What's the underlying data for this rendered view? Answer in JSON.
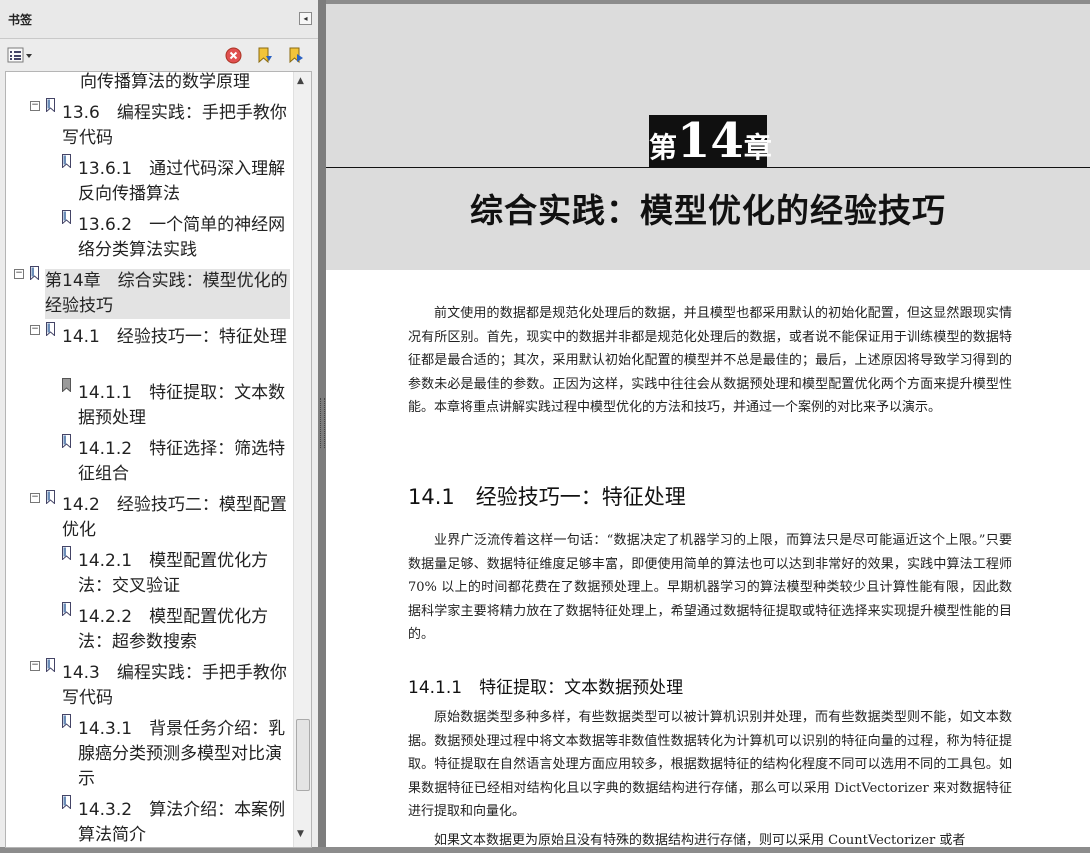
{
  "panel": {
    "title": "书签",
    "collapse_glyph": "◂",
    "toolbar": {
      "options_icon": "list-options-icon",
      "delete_icon": "delete-icon",
      "expand_icon": "expand-bookmark-icon",
      "next_icon": "go-to-bookmark-icon"
    }
  },
  "tree": {
    "items": [
      {
        "label": "向传播算法的数学原理"
      },
      {
        "label": "13.6　编程实践：手把手教你写代码"
      },
      {
        "label": "13.6.1　通过代码深入理解反向传播算法"
      },
      {
        "label": "13.6.2　一个简单的神经网络分类算法实践"
      },
      {
        "label": "第14章　综合实践：模型优化的经验技巧"
      },
      {
        "label": "14.1　经验技巧一：特征处理"
      },
      {
        "label": "14.1.1　特征提取：文本数据预处理"
      },
      {
        "label": "14.1.2　特征选择：筛选特征组合"
      },
      {
        "label": "14.2　经验技巧二：模型配置优化"
      },
      {
        "label": "14.2.1　模型配置优化方法：交叉验证"
      },
      {
        "label": "14.2.2　模型配置优化方法：超参数搜索"
      },
      {
        "label": "14.3　编程实践：手把手教你写代码"
      },
      {
        "label": "14.3.1　背景任务介绍：乳腺癌分类预测多模型对比演示"
      },
      {
        "label": "14.3.2　算法介绍：本案例算法简介"
      }
    ],
    "expander": "−",
    "scroll_up": "▲",
    "scroll_down": "▼"
  },
  "page": {
    "chapter_prefix": "第",
    "chapter_number": "14",
    "chapter_suffix": "章",
    "chapter_title": "综合实践：模型优化的经验技巧",
    "intro": "前文使用的数据都是规范化处理后的数据，并且模型也都采用默认的初始化配置，但这显然跟现实情况有所区别。首先，现实中的数据并非都是规范化处理后的数据，或者说不能保证用于训练模型的数据特征都是最合适的；其次，采用默认初始化配置的模型并不总是最佳的；最后，上述原因将导致学习得到的参数未必是最佳的参数。正因为这样，实践中往往会从数据预处理和模型配置优化两个方面来提升模型性能。本章将重点讲解实践过程中模型优化的方法和技巧，并通过一个案例的对比来予以演示。",
    "section_14_1": "14.1　经验技巧一：特征处理",
    "para_14_1": "业界广泛流传着这样一句话：“数据决定了机器学习的上限，而算法只是尽可能逼近这个上限。”只要数据量足够、数据特征维度足够丰富，即便使用简单的算法也可以达到非常好的效果，实践中算法工程师 70% 以上的时间都花费在了数据预处理上。早期机器学习的算法模型种类较少且计算性能有限，因此数据科学家主要将精力放在了数据特征处理上，希望通过数据特征提取或特征选择来实现提升模型性能的目的。",
    "section_14_1_1": "14.1.1　特征提取：文本数据预处理",
    "para_14_1_1": "原始数据类型多种多样，有些数据类型可以被计算机识别并处理，而有些数据类型则不能，如文本数据。数据预处理过程中将文本数据等非数值性数据转化为计算机可以识别的特征向量的过程，称为特征提取。特征提取在自然语言处理方面应用较多，根据数据特征的结构化程度不同可以选用不同的工具包。如果数据特征已经相对结构化且以字典的数据结构进行存储，那么可以采用 DictVectorizer 来对数据特征进行提取和向量化。",
    "para_last": "如果文本数据更为原始且没有特殊的数据结构进行存储，则可以采用 CountVectorizer 或者"
  }
}
